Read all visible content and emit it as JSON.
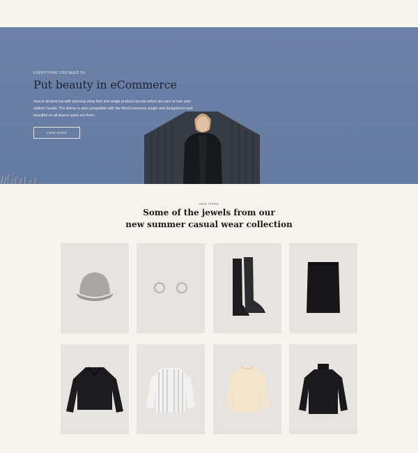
{
  "hero": {
    "eyebrow": "Everything you need to",
    "title": "Put beauty in eCommerce",
    "description": "zara is decked out with stunning shop lists and single product layouts which are sure to turn your visitors' heads. The theme is also compatible with the WooCommerce plugin and designed to look beautiful on all device types out there.",
    "button_label": "View more"
  },
  "collection": {
    "eyebrow": "New items",
    "title_line1": "Some of the jewels from our",
    "title_line2": "new summer casual wear collection",
    "products": [
      {
        "icon": "bucket-hat"
      },
      {
        "icon": "hoop-earrings"
      },
      {
        "icon": "leather-boots"
      },
      {
        "icon": "black-skirt"
      },
      {
        "icon": "black-jacket"
      },
      {
        "icon": "striped-shirt"
      },
      {
        "icon": "cream-sweater"
      },
      {
        "icon": "black-turtleneck"
      }
    ]
  },
  "colors": {
    "page_bg": "#f7f4ef",
    "hero_bg": "#6a7ea3",
    "card_bg": "#e6e4e1",
    "title_dark": "#1d2433"
  }
}
